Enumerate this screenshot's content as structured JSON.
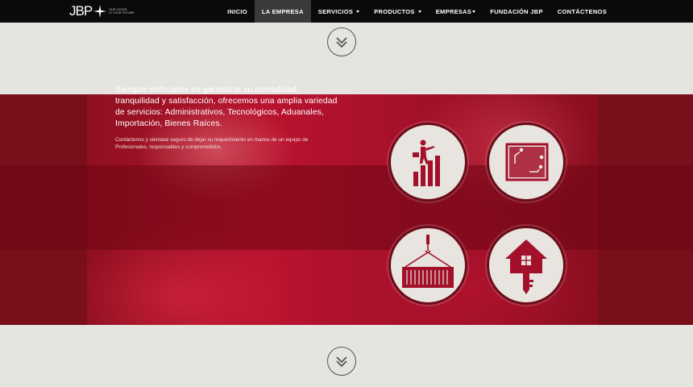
{
  "logo": {
    "text": "JBP",
    "tagline_line1": "OUR VISION",
    "tagline_line2": "IS YOUR FUTURE"
  },
  "nav": {
    "items": [
      {
        "label": "INICIO",
        "active": false,
        "dropdown": false
      },
      {
        "label": "LA EMPRESA",
        "active": true,
        "dropdown": false
      },
      {
        "label": "SERVICIOS",
        "active": false,
        "dropdown": true
      },
      {
        "label": "PRODUCTOS",
        "active": false,
        "dropdown": true
      },
      {
        "label": "EMPRESAS",
        "active": false,
        "dropdown": true
      },
      {
        "label": "FUNDACIÓN JBP",
        "active": false,
        "dropdown": false
      },
      {
        "label": "CONTÁCTENOS",
        "active": false,
        "dropdown": false
      }
    ]
  },
  "hero": {
    "main_text": "Siempre enfocados en garantizar su comodidad, tranquilidad y satisfacción, ofrecemos  una amplia variedad de servicios: Administrativos, Tecnológicos, Aduanales, Importación, Bienes Raíces.",
    "sub_text": "Contáctenos y siéntase seguro de dejar su requerimiento en manos de un equipo de Profesionales, responsables y comprometidos."
  },
  "features": [
    {
      "icon": "business-growth-icon"
    },
    {
      "icon": "circuit-board-icon"
    },
    {
      "icon": "shipping-container-icon"
    },
    {
      "icon": "house-key-icon"
    }
  ],
  "colors": {
    "navbar": "#0a0a0a",
    "active_nav": "#3a3a3a",
    "background": "#e6e4df",
    "hero_red": "#b9132f",
    "icon_red": "#a3102a"
  }
}
